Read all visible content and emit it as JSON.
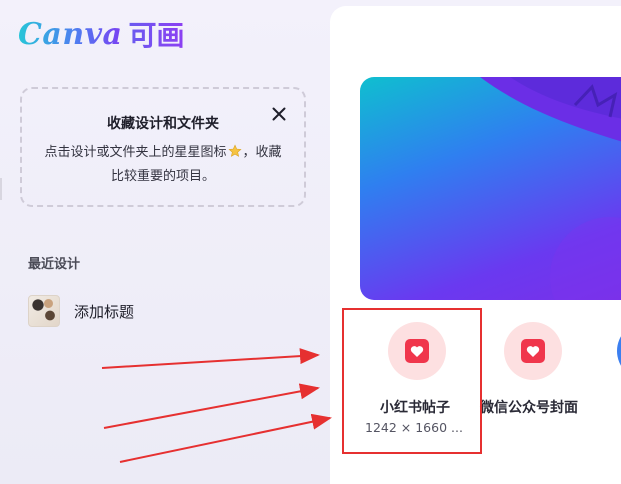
{
  "app": {
    "logo_latin": "Canva",
    "logo_cjk": "可画"
  },
  "tip_card": {
    "title": "收藏设计和文件夹",
    "body_line1_before": "点击设计或文件夹上的星星图标",
    "body_line1_after": "，收藏",
    "body_line2": "比较重要的项目。",
    "close_icon": "close-icon",
    "star_icon": "star-icon"
  },
  "recent": {
    "section_label": "最近设计",
    "items": [
      {
        "label": "添加标题"
      }
    ]
  },
  "templates": [
    {
      "name": "小红书帖子",
      "size": "1242 × 1660 ...",
      "icon": "heart-icon"
    },
    {
      "name": "微信公众号封面",
      "size": "",
      "icon": "heart-icon"
    }
  ],
  "colors": {
    "accent_red": "#f0364c",
    "icon_bg_pink": "#fde0e1",
    "annotation_red": "#e63030",
    "brand_cyan": "#27c6d8",
    "brand_purple": "#7b3ff2"
  }
}
